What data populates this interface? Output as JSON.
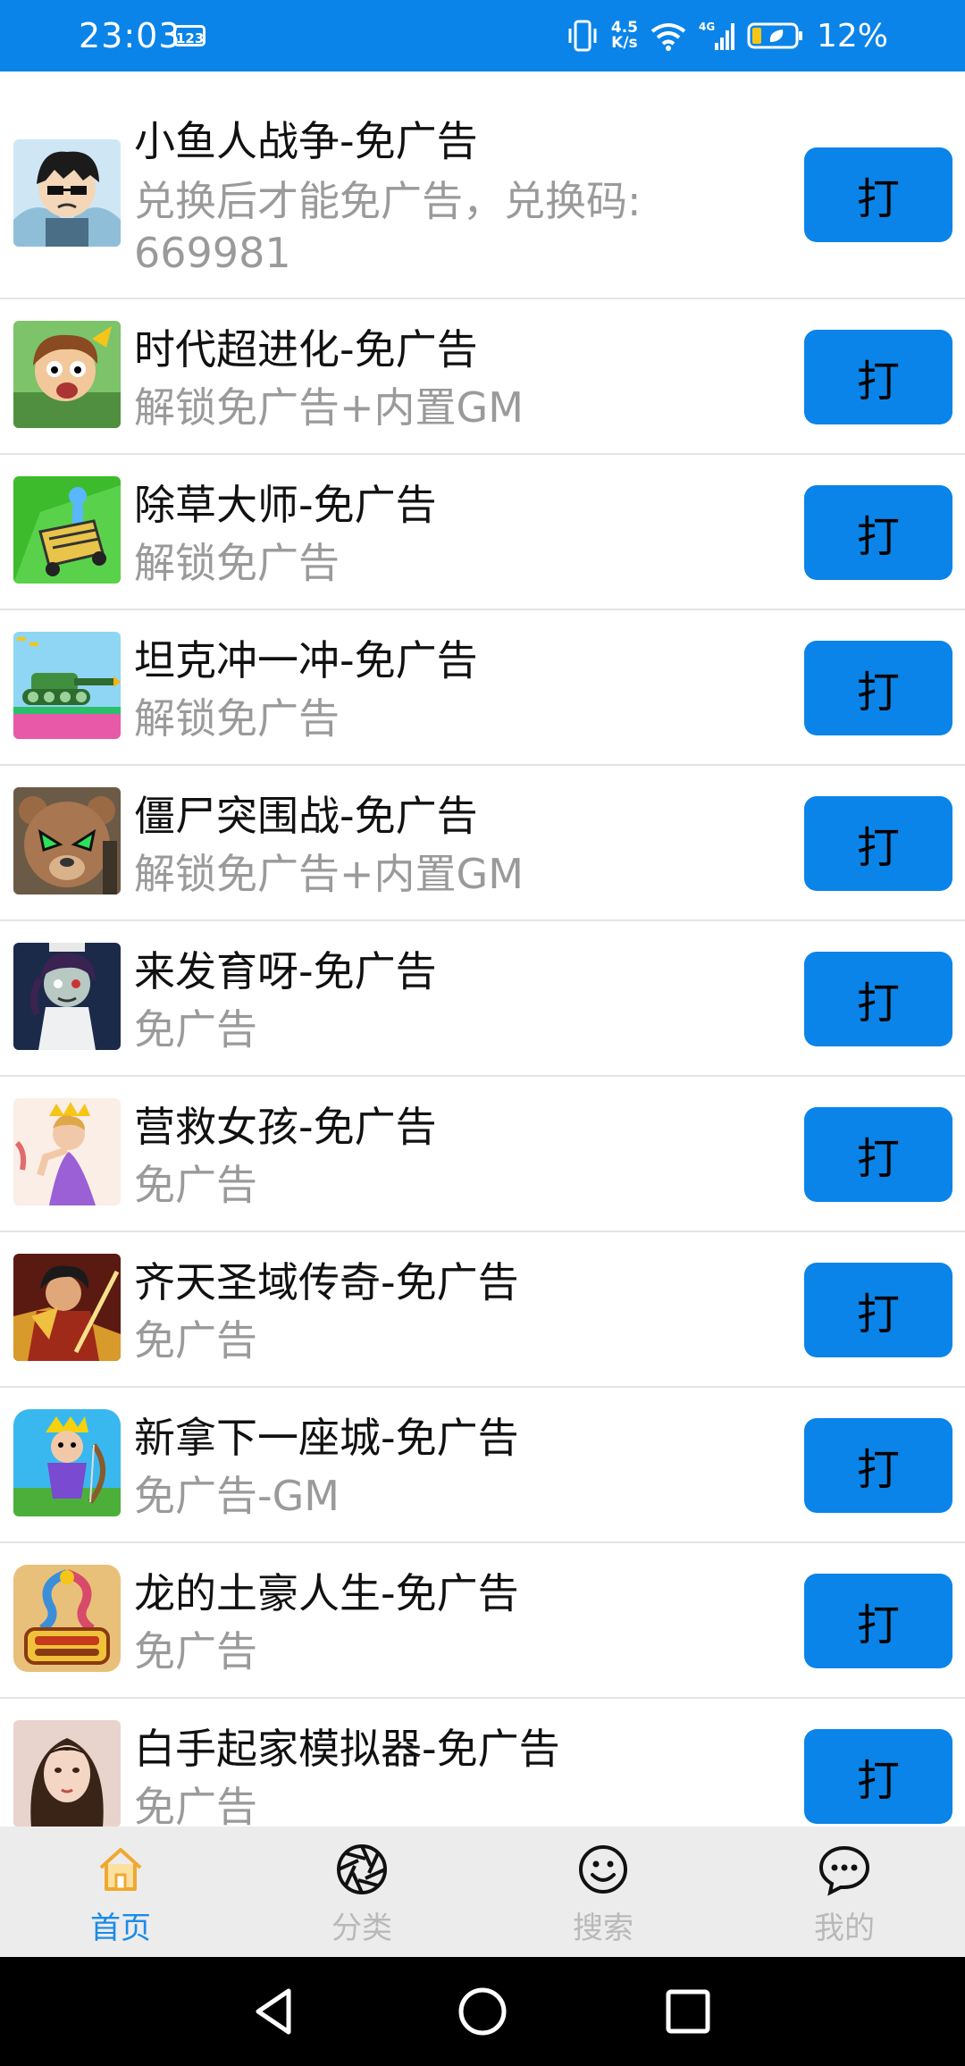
{
  "status_bar": {
    "time": "23:03",
    "kb_badge": "123",
    "net_speed_top": "4.5",
    "net_speed_bottom": "K/s",
    "signal_label": "4G",
    "battery": "12%"
  },
  "colors": {
    "accent": "#0a84e8",
    "tab_active": "#1a8be8",
    "tab_inactive": "#b9b9b9",
    "title_text": "#111111",
    "sub_text": "#9a9a9a"
  },
  "apps": [
    {
      "title": "小鱼人战争-免广告",
      "subtitle": "兑换后才能免广告，兑换码: 669981",
      "button": "打",
      "icon": "cartoon-boy-icon"
    },
    {
      "title": "时代超进化-免广告",
      "subtitle": "解锁免广告+内置GM",
      "button": "打",
      "icon": "caveman-icon"
    },
    {
      "title": "除草大师-免广告",
      "subtitle": "解锁免广告",
      "button": "打",
      "icon": "lawnmower-icon"
    },
    {
      "title": "坦克冲一冲-免广告",
      "subtitle": "解锁免广告",
      "button": "打",
      "icon": "tank-icon"
    },
    {
      "title": "僵尸突围战-免广告",
      "subtitle": "解锁免广告+内置GM",
      "button": "打",
      "icon": "bear-zombie-icon"
    },
    {
      "title": "来发育呀-免广告",
      "subtitle": "免广告",
      "button": "打",
      "icon": "zombie-girl-icon"
    },
    {
      "title": "营救女孩-免广告",
      "subtitle": "免广告",
      "button": "打",
      "icon": "princess-icon"
    },
    {
      "title": "齐天圣域传奇-免广告",
      "subtitle": "免广告",
      "button": "打",
      "icon": "warrior-icon"
    },
    {
      "title": "新拿下一座城-免广告",
      "subtitle": "免广告-GM",
      "button": "打",
      "icon": "king-archer-icon"
    },
    {
      "title": "龙的土豪人生-免广告",
      "subtitle": "免广告",
      "button": "打",
      "icon": "dragon-icon"
    },
    {
      "title": "白手起家模拟器-免广告",
      "subtitle": "免广告",
      "button": "打",
      "icon": "girl-portrait-icon"
    }
  ],
  "tabs": [
    {
      "label": "首页",
      "icon": "home-icon",
      "active": true
    },
    {
      "label": "分类",
      "icon": "aperture-icon",
      "active": false
    },
    {
      "label": "搜索",
      "icon": "smiley-icon",
      "active": false
    },
    {
      "label": "我的",
      "icon": "chat-bubble-icon",
      "active": false
    }
  ],
  "nav": [
    "back-icon",
    "home-circle-icon",
    "recents-icon"
  ]
}
